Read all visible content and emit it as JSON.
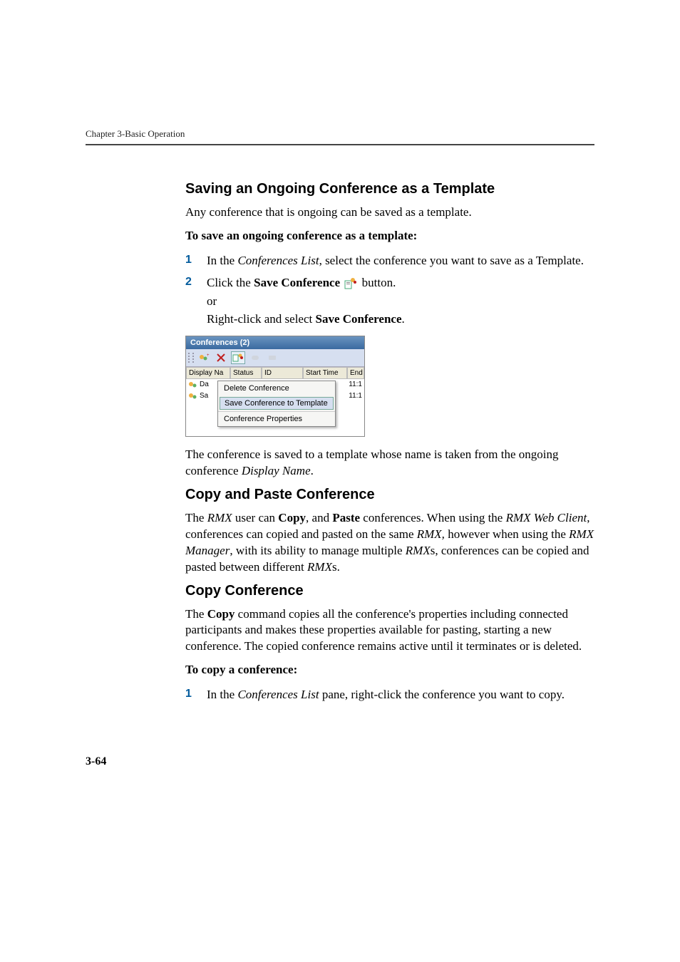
{
  "chapter_header": "Chapter 3-Basic Operation",
  "h1": "Saving an Ongoing Conference as a Template",
  "p1": "Any conference that is ongoing can be saved as a template.",
  "p2_bold": "To save an ongoing conference as a template:",
  "step1_pre": "In the ",
  "step1_em": "Conferences List",
  "step1_post": ", select the conference you want to save as a Template.",
  "step2_pre": "Click the ",
  "step2_bold": "Save Conference",
  "step2_post": "  button.",
  "step2_or": "or",
  "step2_alt_pre": "Right-click and select ",
  "step2_alt_bold": "Save Conference",
  "step2_alt_post": ".",
  "ss": {
    "title": "Conferences (2)",
    "headers": {
      "c1": "Display Na",
      "c2": "Status",
      "c3": "ID",
      "c4": "Start Time",
      "c5": "End T"
    },
    "rows": [
      {
        "name": "Da",
        "t": "11:1"
      },
      {
        "name": "Sa",
        "t": "11:1"
      }
    ],
    "menu": {
      "i1": "Delete Conference",
      "i2": "Save Conference to Template",
      "i3": "Conference Properties"
    }
  },
  "p_after_ss_a": "The conference is saved to a template whose name is taken from the ongoing conference ",
  "p_after_ss_em": "Display Name",
  "p_after_ss_b": ".",
  "h2": "Copy and Paste Conference",
  "p_cp_1a": "The ",
  "p_cp_1b": "RMX",
  "p_cp_1c": " user can ",
  "p_cp_1d": "Copy",
  "p_cp_1e": ", and ",
  "p_cp_1f": "Paste",
  "p_cp_1g": " conferences. When using the ",
  "p_cp_1h": "RMX Web Client",
  "p_cp_1i": ", conferences can copied and pasted on the same ",
  "p_cp_1j": "RMX,",
  "p_cp_1k": " however when using the ",
  "p_cp_1l": "RMX Manager",
  "p_cp_1m": ", with its ability to manage multiple ",
  "p_cp_1n": "RMX",
  "p_cp_1o": "s, conferences can be copied and pasted between different ",
  "p_cp_1p": "RMX",
  "p_cp_1q": "s.",
  "h3": "Copy Conference",
  "p_cc_a": "The ",
  "p_cc_b": "Copy",
  "p_cc_c": " command copies all the conference's properties including connected participants and makes these properties available for pasting, starting a new conference. The copied conference remains active until it terminates or is deleted.",
  "p_cc_bold": "To copy a conference:",
  "cc_step1_a": "In the ",
  "cc_step1_em": "Conferences List",
  "cc_step1_b": " pane, right-click the conference you want to copy.",
  "page_number": "3-64"
}
